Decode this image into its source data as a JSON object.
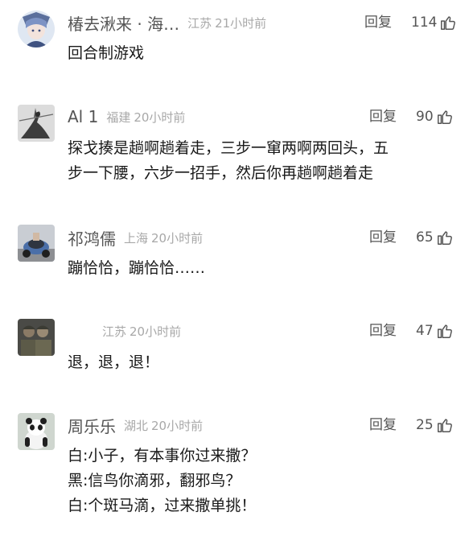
{
  "comments": [
    {
      "username": "椿去湫来 · 海…",
      "location": "江苏",
      "time": "21小时前",
      "reply_label": "回复",
      "likes": "114",
      "avatar": "anime-character-avatar",
      "lines": [
        "回合制游戏"
      ]
    },
    {
      "username": "Al 1",
      "location": "福建",
      "time": "20小时前",
      "reply_label": "回复",
      "likes": "90",
      "avatar": "ink-warrior-avatar",
      "lines": [
        "探戈揍是趟啊趟着走，三步一窜两啊两回头，五",
        "步一下腰，六步一招手，然后你再趟啊趟着走"
      ]
    },
    {
      "username": "祁鸿儒",
      "location": "上海",
      "time": "20小时前",
      "reply_label": "回复",
      "likes": "65",
      "avatar": "scooter-photo-avatar",
      "lines": [
        "蹦恰恰，蹦恰恰……"
      ]
    },
    {
      "username": "",
      "location": "江苏",
      "time": "20小时前",
      "reply_label": "回复",
      "likes": "47",
      "avatar": "soldiers-photo-avatar",
      "lines": [
        "退，退，退！"
      ]
    },
    {
      "username": "周乐乐",
      "location": "湖北",
      "time": "20小时前",
      "reply_label": "回复",
      "likes": "25",
      "avatar": "panda-avatar",
      "lines": [
        "白:小子，有本事你过来撒？",
        "黑:信鸟你滴邪，翻邪鸟？",
        "白:个斑马滴，过来撒单挑！"
      ]
    }
  ],
  "colors": {
    "username": "#555555",
    "meta": "#a8a8a8",
    "text": "#1a1a1a",
    "icon": "#555555"
  },
  "icons": {
    "like": "thumbs-up-icon"
  }
}
